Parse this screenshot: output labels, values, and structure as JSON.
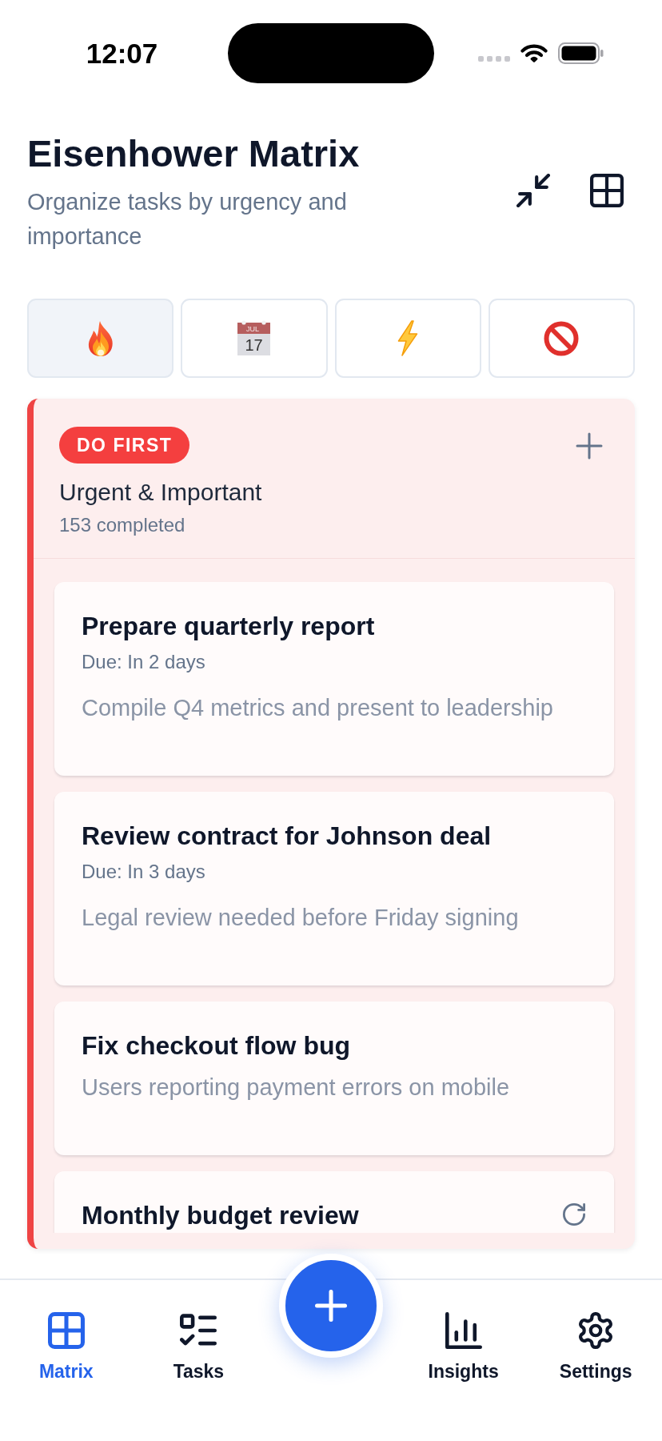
{
  "status_bar": {
    "time": "12:07"
  },
  "header": {
    "title": "Eisenhower Matrix",
    "subtitle": "Organize tasks by urgency and importance"
  },
  "quadrant_tabs": [
    {
      "selected": true
    },
    {
      "selected": false,
      "month": "JUL",
      "day": "17"
    },
    {
      "selected": false
    },
    {
      "selected": false
    }
  ],
  "quadrant": {
    "badge": "DO FIRST",
    "title": "Urgent & Important",
    "completed": "153 completed",
    "tasks": [
      {
        "title": "Prepare quarterly report",
        "due": "Due: In 2 days",
        "description": "Compile Q4 metrics and present to leadership",
        "recurring": false
      },
      {
        "title": "Review contract for Johnson deal",
        "due": "Due: In 3 days",
        "description": "Legal review needed before Friday signing",
        "recurring": false
      },
      {
        "title": "Fix checkout flow bug",
        "description": "Users reporting payment errors on mobile",
        "recurring": false
      },
      {
        "title": "Monthly budget review",
        "recurring": true
      }
    ]
  },
  "bottom_nav": [
    {
      "label": "Matrix",
      "selected": true
    },
    {
      "label": "Tasks",
      "selected": false
    },
    {
      "label": "Insights",
      "selected": false
    },
    {
      "label": "Settings",
      "selected": false
    }
  ]
}
